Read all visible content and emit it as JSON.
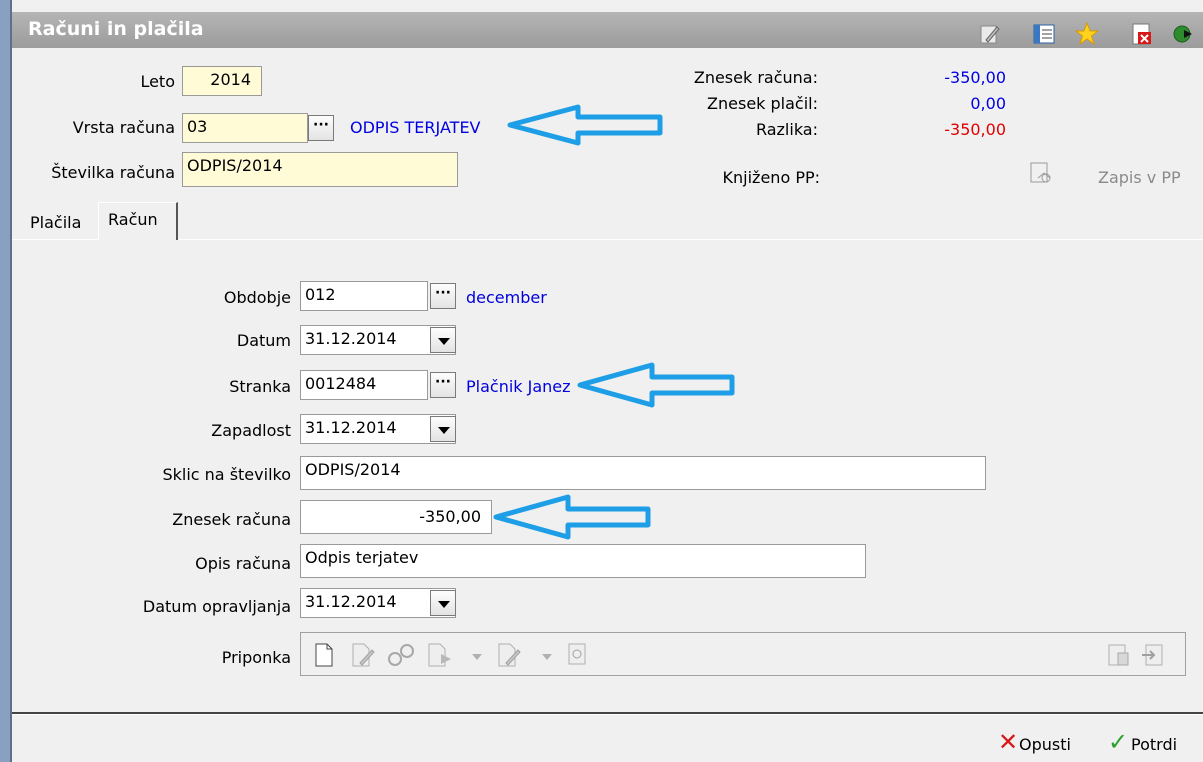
{
  "window": {
    "title": "Računi in plačila",
    "toolbar_icons": [
      "edit-icon",
      "form-icon",
      "star-icon",
      "close-document-icon",
      "exit-icon"
    ]
  },
  "header": {
    "leto": {
      "label": "Leto",
      "value": "2014"
    },
    "vrsta": {
      "label": "Vrsta računa",
      "value": "03",
      "description": "ODPIS TERJATEV"
    },
    "stevilka": {
      "label": "Številka računa",
      "value": "ODPIS/2014"
    }
  },
  "summary": {
    "znesek_racuna": {
      "label": "Znesek računa:",
      "value": "-350,00"
    },
    "znesek_placil": {
      "label": "Znesek plačil:",
      "value": "0,00"
    },
    "razlika": {
      "label": "Razlika:",
      "value": "-350,00"
    },
    "knjizeno": {
      "label": "Knjiženo PP:"
    },
    "zapis_button": "Zapis v PP"
  },
  "tabs": [
    {
      "label": "Plačila",
      "active": false
    },
    {
      "label": "Račun",
      "active": true
    }
  ],
  "form": {
    "obdobje": {
      "label": "Obdobje",
      "value": "012",
      "description": "december"
    },
    "datum": {
      "label": "Datum",
      "value": "31.12.2014"
    },
    "stranka": {
      "label": "Stranka",
      "value": "0012484",
      "description": "Plačnik Janez"
    },
    "zapadlost": {
      "label": "Zapadlost",
      "value": "31.12.2014"
    },
    "sklic": {
      "label": "Sklic na številko",
      "value": "ODPIS/2014"
    },
    "znesek": {
      "label": "Znesek računa",
      "value": "-350,00"
    },
    "opis": {
      "label": "Opis računa",
      "value": "Odpis terjatev"
    },
    "datum_opravljanja": {
      "label": "Datum opravljanja",
      "value": "31.12.2014"
    },
    "priponka": {
      "label": "Priponka"
    }
  },
  "footer": {
    "cancel_label": "Opusti",
    "confirm_label": "Potrdi"
  },
  "colors": {
    "title_bar": "#a9a9a9",
    "link_blue": "#0000e0",
    "negative_red": "#e00000",
    "annotation_arrow": "#1e9ee6",
    "field_yellow": "#fffbd6"
  }
}
